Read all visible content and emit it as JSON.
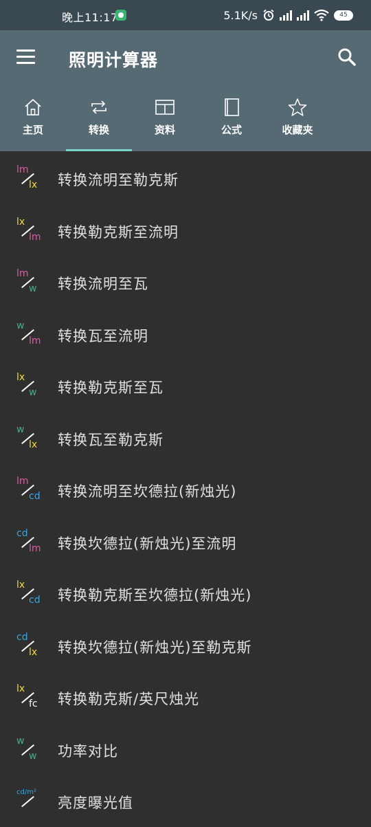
{
  "status_bar": {
    "time": "晚上11:17",
    "network_speed": "5.1K/s",
    "battery_level": "45",
    "icons": [
      "app-badge-icon",
      "alarm-icon",
      "signal-icon",
      "signal-icon",
      "wifi-icon",
      "battery-icon"
    ]
  },
  "app_bar": {
    "title": "照明计算器",
    "menu_icon": "hamburger-menu-icon",
    "search_icon": "search-icon",
    "background": "#566a74"
  },
  "tabs": [
    {
      "label": "主页",
      "icon": "home-icon",
      "active": false
    },
    {
      "label": "转换",
      "icon": "repeat-icon",
      "active": true
    },
    {
      "label": "资料",
      "icon": "table-icon",
      "active": false
    },
    {
      "label": "公式",
      "icon": "book-icon",
      "active": false
    },
    {
      "label": "收藏夹",
      "icon": "star-icon",
      "active": false
    }
  ],
  "colors": {
    "lm": "#e05aa6",
    "lx": "#f2dc3c",
    "w": "#4fa890",
    "cd": "#3aa6e0",
    "fc": "#ffffff",
    "tab_indicator": "#7fd6c8",
    "list_background": "#2f2f2f"
  },
  "items": [
    {
      "label": "转换流明至勒克斯",
      "icon_top": "lm",
      "icon_bottom": "lx"
    },
    {
      "label": "转换勒克斯至流明",
      "icon_top": "lx",
      "icon_bottom": "lm"
    },
    {
      "label": "转换流明至瓦",
      "icon_top": "lm",
      "icon_bottom": "w"
    },
    {
      "label": "转换瓦至流明",
      "icon_top": "w",
      "icon_bottom": "lm"
    },
    {
      "label": "转换勒克斯至瓦",
      "icon_top": "lx",
      "icon_bottom": "w"
    },
    {
      "label": "转换瓦至勒克斯",
      "icon_top": "w",
      "icon_bottom": "lx"
    },
    {
      "label": "转换流明至坎德拉(新烛光)",
      "icon_top": "lm",
      "icon_bottom": "cd"
    },
    {
      "label": "转换坎德拉(新烛光)至流明",
      "icon_top": "cd",
      "icon_bottom": "lm"
    },
    {
      "label": "转换勒克斯至坎德拉(新烛光)",
      "icon_top": "lx",
      "icon_bottom": "cd"
    },
    {
      "label": "转换坎德拉(新烛光)至勒克斯",
      "icon_top": "cd",
      "icon_bottom": "lx"
    },
    {
      "label": "转换勒克斯/英尺烛光",
      "icon_top": "lx",
      "icon_bottom": "fc"
    },
    {
      "label": "功率对比",
      "icon_top": "w",
      "icon_bottom": "w"
    },
    {
      "label": "亮度曝光值",
      "icon_top": "cd/m²",
      "icon_bottom": ""
    }
  ]
}
